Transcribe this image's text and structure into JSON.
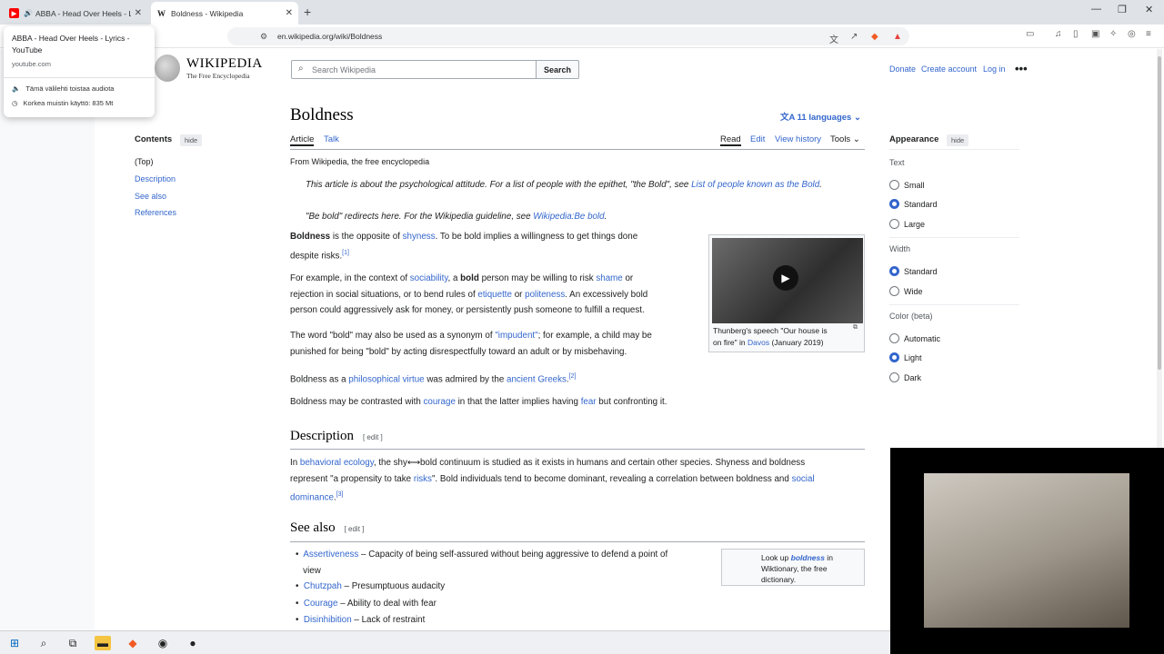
{
  "browser": {
    "tabs": [
      {
        "title": "ABBA - Head Over Heels - Lyr",
        "favicon": "youtube-icon"
      },
      {
        "title": "Boldness - Wikipedia",
        "favicon": "wikipedia-icon"
      }
    ],
    "new_tab": "+",
    "url": "en.wikipedia.org/wiki/Boldness",
    "hover_card": {
      "title": "ABBA - Head Over Heels - Lyrics - YouTube",
      "domain": "youtube.com",
      "audio_text": "Tämä välilehti toistaa audiota",
      "memory_text": "Korkea muistin käyttö: 835 Mt"
    },
    "window_controls": {
      "min": "—",
      "max": "❐",
      "close": "✕"
    }
  },
  "wiki": {
    "logo_title": "WIKIPEDIA",
    "logo_subtitle": "The Free Encyclopedia",
    "search_placeholder": "Search Wikipedia",
    "search_button": "Search",
    "top_links": {
      "donate": "Donate",
      "create_account": "Create account",
      "login": "Log in"
    },
    "title": "Boldness",
    "languages": "11 languages",
    "tabs": {
      "article": "Article",
      "talk": "Talk",
      "read": "Read",
      "edit": "Edit",
      "history": "View history",
      "tools": "Tools"
    },
    "toc": {
      "title": "Contents",
      "hide": "hide",
      "items": [
        "(Top)",
        "Description",
        "See also",
        "References"
      ]
    },
    "from": "From Wikipedia, the free encyclopedia",
    "hatnote1_a": "This article is about the psychological attitude. For a list of people with the epithet, \"the Bold\", see ",
    "hatnote1_link": "List of people known as the Bold",
    "hatnote1_end": ".",
    "hatnote2_a": "\"Be bold\" redirects here. For the Wikipedia guideline, see ",
    "hatnote2_link": "Wikipedia:Be bold",
    "hatnote2_end": ".",
    "p1": {
      "bold": "Boldness",
      "a": " is the opposite of ",
      "link": "shyness",
      "b": ". To be bold implies a willingness to get things done",
      "c": "despite risks.",
      "ref": "[1]"
    },
    "p2": {
      "a": "For example, in the context of ",
      "l1": "sociability",
      "b": ", a ",
      "bold": "bold",
      "c": " person may be willing to risk ",
      "l2": "shame",
      "d": " or",
      "e": "rejection in social situations, or to bend rules of ",
      "l3": "etiquette",
      "f": " or ",
      "l4": "politeness",
      "g": ". An excessively bold",
      "h": "person could aggressively ask for money, or persistently push someone to fulfill a request."
    },
    "p3": {
      "a": "The word \"bold\" may also be used as a synonym of ",
      "link": "\"impudent\"",
      "b": "; for example, a child may be",
      "c": "punished for being \"bold\" by acting disrespectfully toward an adult or by misbehaving."
    },
    "p4": {
      "a": "Boldness as a ",
      "l1": "philosophical virtue",
      "b": " was admired by the ",
      "l2": "ancient Greeks",
      "c": ".",
      "ref": "[2]"
    },
    "p5": {
      "a": "Boldness may be contrasted with ",
      "l1": "courage",
      "b": " in that the latter implies having ",
      "l2": "fear",
      "c": " but confronting it."
    },
    "thumb": {
      "caption_a": "Thunberg's speech \"Our house is",
      "caption_b": "on fire\" in ",
      "caption_link": "Davos",
      "caption_c": " (January 2019)"
    },
    "description": {
      "heading": "Description",
      "edit": "[ edit ]",
      "a": "In ",
      "l1": "behavioral ecology",
      "b": ", the shy⟷bold continuum is studied as it exists in humans and certain other species. Shyness and boldness",
      "c": "represent \"a propensity to take ",
      "l2": "risks",
      "d": "\". Bold individuals tend to become dominant, revealing a correlation between boldness and ",
      "l3": "social",
      "l4": "dominance",
      "e": ".",
      "ref": "[3]"
    },
    "see_also": {
      "heading": "See also",
      "edit": "[ edit ]",
      "items": [
        {
          "link": "Assertiveness",
          "desc": " – Capacity of being self-assured without being aggressive to defend a point of",
          "desc2": "view"
        },
        {
          "link": "Chutzpah",
          "desc": " – Presumptuous audacity"
        },
        {
          "link": "Courage",
          "desc": " – Ability to deal with fear"
        },
        {
          "link": "Disinhibition",
          "desc": " – Lack of restraint"
        }
      ],
      "wiktionary": {
        "a": "Look up ",
        "word": "boldness",
        "b": " in",
        "c": "Wiktionary, the free",
        "d": "dictionary."
      }
    },
    "appearance": {
      "title": "Appearance",
      "hide": "hide",
      "text_label": "Text",
      "text_options": [
        "Small",
        "Standard",
        "Large"
      ],
      "text_selected": "Standard",
      "width_label": "Width",
      "width_options": [
        "Standard",
        "Wide"
      ],
      "width_selected": "Standard",
      "color_label": "Color (beta)",
      "color_options": [
        "Automatic",
        "Light",
        "Dark"
      ],
      "color_selected": "Light"
    }
  },
  "colors": {
    "link": "#3366cc",
    "radio_selected": "#3366cc",
    "tabbar": "#dfe3e8"
  }
}
